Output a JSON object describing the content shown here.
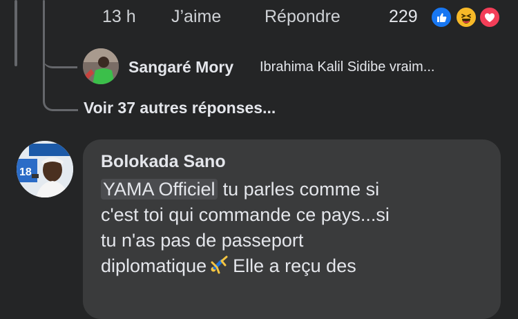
{
  "action_row": {
    "time": "13 h",
    "like": "J’aime",
    "reply": "Répondre",
    "reaction_count": "229",
    "reaction_icons": [
      "like-icon",
      "haha-icon",
      "love-icon"
    ],
    "colors": {
      "like": "#1877f2",
      "haha": "#f7b928",
      "love": "#f33e58"
    }
  },
  "reply_preview": {
    "author": "Sangaré Mory",
    "text": "Ibrahima Kalil Sidibe vraim..."
  },
  "more_replies": "Voir 37 autres réponses...",
  "comment": {
    "author": "Bolokada Sano",
    "mention": "YAMA Officiel",
    "line1": "tu parles comme si",
    "line2": "c'est toi qui commande ce pays...si",
    "line3": "tu n'as pas de passeport",
    "line4_start": "diplomatique",
    "line4_end": "Elle a reçu des",
    "avatar_badge": "18"
  }
}
